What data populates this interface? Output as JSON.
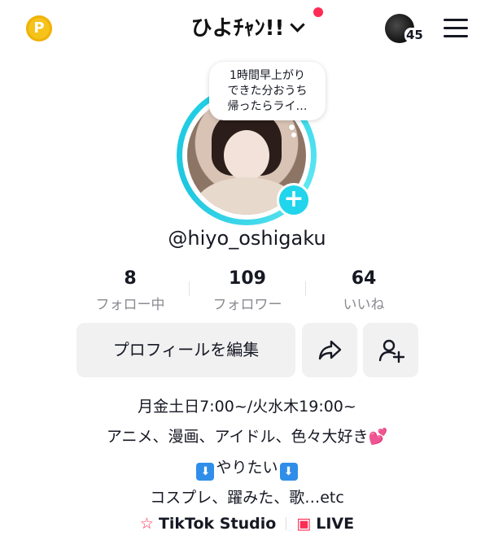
{
  "header": {
    "coin_letter": "P",
    "title": "ひよﾁｬﾝ!!",
    "notification_count": "45"
  },
  "profile": {
    "bubble_lines": [
      "1時間早上がり",
      "できた分おうち",
      "帰ったらライ…"
    ],
    "username": "@hiyo_oshigaku"
  },
  "stats": [
    {
      "value": "8",
      "label": "フォロー中"
    },
    {
      "value": "109",
      "label": "フォロワー"
    },
    {
      "value": "64",
      "label": "いいね"
    }
  ],
  "actions": {
    "edit_label": "プロフィールを編集"
  },
  "bio": {
    "line1": "月金土日7:00~/火水木19:00~",
    "line2": "アニメ、漫画、アイドル、色々大好き",
    "line2_emoji": "💕",
    "line3_arrow": "⬇",
    "line3_text": "やりたい",
    "line4": "コスプレ、躍みた、歌…etc"
  },
  "links": {
    "studio": "TikTok Studio",
    "live": "LIVE"
  },
  "colors": {
    "accent_cyan": "#20d5ec",
    "red": "#fe2c55",
    "coin": "#f6c31a"
  }
}
